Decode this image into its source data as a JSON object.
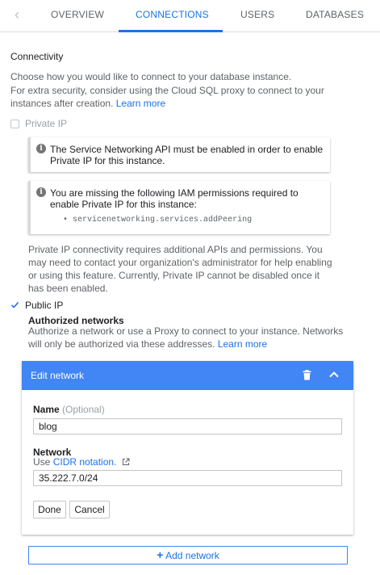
{
  "tabs": {
    "back_glyph": "‹",
    "items": [
      {
        "label": "OVERVIEW",
        "active": false
      },
      {
        "label": "CONNECTIONS",
        "active": true
      },
      {
        "label": "USERS",
        "active": false
      },
      {
        "label": "DATABASES",
        "active": false
      }
    ]
  },
  "connectivity": {
    "title": "Connectivity",
    "intro": "Choose how you would like to connect to your database instance.",
    "proxy_text": "For extra security, consider using the Cloud SQL proxy to connect to your instances after creation.",
    "learn_more": "Learn more"
  },
  "private_ip": {
    "label": "Private IP",
    "checked": false,
    "notice_api": "The Service Networking API must be enabled in order to enable Private IP for this instance.",
    "notice_iam": "You are missing the following IAM permissions required to enable Private IP for this instance:",
    "permission": "servicenetworking.services.addPeering",
    "bullet": "•",
    "info_glyph": "i",
    "note": "Private IP connectivity requires additional APIs and permissions. You may need to contact your organization's administrator for help enabling or using this feature. Currently, Private IP cannot be disabled once it has been enabled."
  },
  "public_ip": {
    "label": "Public IP",
    "checked": true,
    "authorized_title": "Authorized networks",
    "authorized_desc": "Authorize a network or use a Proxy to connect to your instance. Networks will only be authorized via these addresses.",
    "learn_more": "Learn more"
  },
  "edit_network": {
    "title": "Edit network",
    "name_label": "Name",
    "name_optional": "(Optional)",
    "name_value": "blog",
    "network_label": "Network",
    "network_hint_prefix": "Use",
    "network_hint_link": "CIDR notation.",
    "network_value": "35.222.7.0/24",
    "done_label": "Done",
    "cancel_label": "Cancel"
  },
  "add_network": {
    "plus": "+",
    "label": "Add network"
  },
  "colors": {
    "accent": "#1a73e8",
    "header_blue": "#4285f4"
  }
}
